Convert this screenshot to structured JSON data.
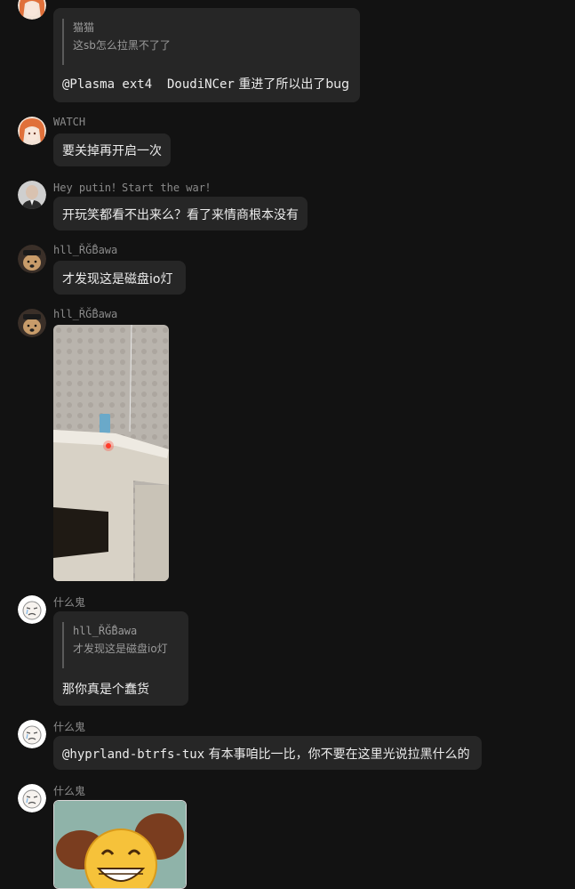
{
  "messages": [
    {
      "quote": {
        "author": "猫猫",
        "text": "这sb怎么拉黑不了了"
      },
      "mention": "@Plasma ext4  DoudiNCer",
      "text": "重进了所以出了bug"
    },
    {
      "author": "WATCH",
      "text": "要关掉再开启一次"
    },
    {
      "author": "Hey putin！Start the war！",
      "text": "开玩笑都看不出来么？看了来情商根本没有"
    },
    {
      "author": "hll_ŘĞ̊Bawa",
      "text": "才发现这是磁盘io灯"
    },
    {
      "author": "hll_ŘĞ̊Bawa",
      "image": "photo-of-device-with-red-disk-led"
    },
    {
      "author": "什么鬼",
      "quote": {
        "author": "hll_ŘĞ̊Bawa",
        "text": "才发现这是磁盘io灯"
      },
      "text": "那你真是个蠢货"
    },
    {
      "author": "什么鬼",
      "mention": "@hyprland-btrfs-tux",
      "text": "有本事咱比一比，你不要在这里光说拉黑什么的"
    },
    {
      "author": "什么鬼",
      "image": "grinning-face-sticker"
    }
  ],
  "colors": {
    "background": "#121212",
    "bubble": "#262626",
    "name": "#8a8a8a",
    "quote_bar": "#5a5a5a"
  },
  "icons": {
    "avatar_1": "orange-hair-anime-avatar",
    "avatar_2": "man-in-suit-avatar",
    "avatar_3": "dog-with-hat-avatar",
    "avatar_4": "crying-cartoon-avatar"
  }
}
